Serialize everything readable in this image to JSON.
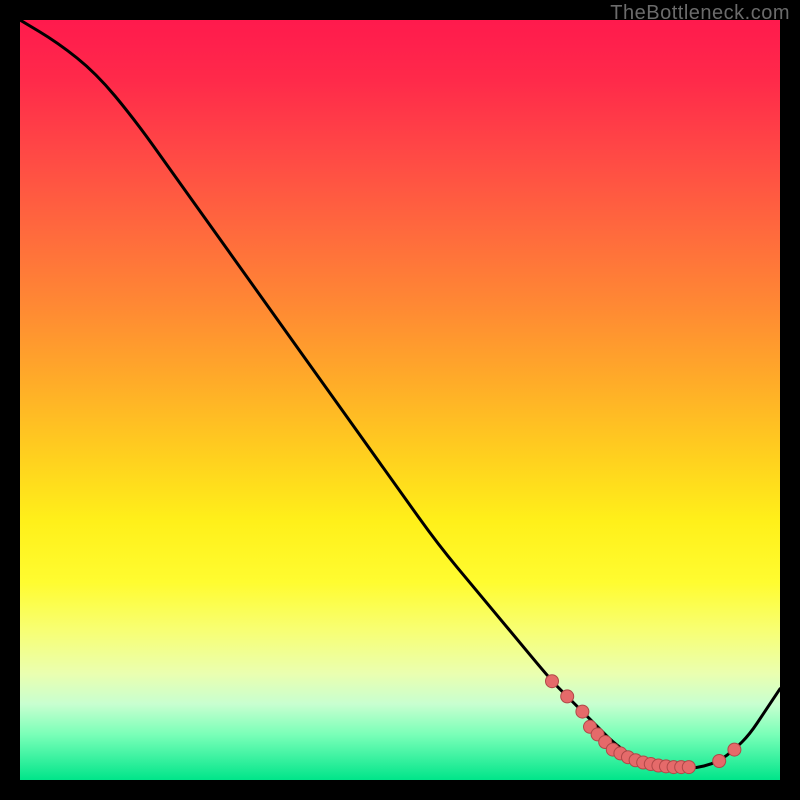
{
  "attribution": "TheBottleneck.com",
  "colors": {
    "background": "#000000",
    "curve_stroke": "#000000",
    "dots_fill": "#e56a6a",
    "dots_stroke": "#b04848",
    "gradient_top": "#ff1a4d",
    "gradient_bottom": "#00e58a"
  },
  "chart_data": {
    "type": "line",
    "title": "",
    "xlabel": "",
    "ylabel": "",
    "xlim": [
      0,
      100
    ],
    "ylim": [
      0,
      100
    ],
    "grid": false,
    "curve": {
      "name": "bottleneck-curve",
      "x": [
        0,
        5,
        10,
        15,
        20,
        25,
        30,
        35,
        40,
        45,
        50,
        55,
        60,
        65,
        70,
        72,
        74,
        76,
        78,
        80,
        82,
        84,
        86,
        88,
        90,
        92,
        94,
        96,
        98,
        100
      ],
      "y": [
        100,
        97,
        93,
        87,
        80,
        73,
        66,
        59,
        52,
        45,
        38,
        31,
        25,
        19,
        13,
        11,
        9,
        7,
        5,
        3.5,
        2.5,
        1.8,
        1.5,
        1.5,
        1.8,
        2.5,
        4,
        6,
        9,
        12
      ]
    },
    "dots": {
      "name": "optimal-zone-dots",
      "x": [
        70,
        72,
        74,
        75,
        76,
        77,
        78,
        79,
        80,
        81,
        82,
        83,
        84,
        85,
        86,
        87,
        88,
        92,
        94
      ],
      "y": [
        13,
        11,
        9,
        7,
        6,
        5,
        4,
        3.5,
        3,
        2.6,
        2.3,
        2.1,
        1.9,
        1.8,
        1.7,
        1.7,
        1.7,
        2.5,
        4
      ]
    }
  }
}
